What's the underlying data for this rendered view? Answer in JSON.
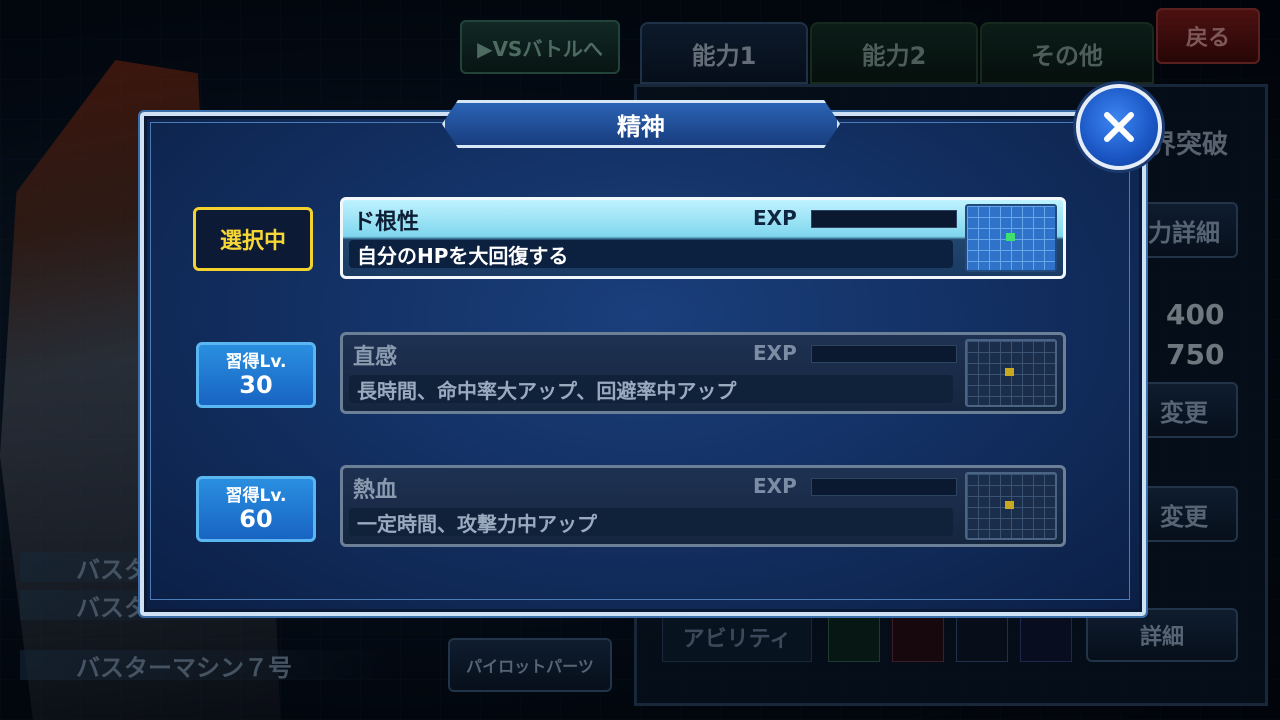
{
  "background": {
    "vs_battle_button": "▶VSバトルへ",
    "back_button": "戻る",
    "tabs": [
      "能力1",
      "能力2",
      "その他"
    ],
    "right_panel": {
      "limit_break": "界突破",
      "ability_detail_button": "力詳細",
      "stat_values": [
        "400",
        "750"
      ],
      "change_buttons": [
        "変更",
        "変更"
      ],
      "ability_label": "アビリティ",
      "detail_button": "詳細"
    },
    "nameplates": [
      "バスタ",
      "バスタ",
      "バスターマシン７号"
    ],
    "pilot_parts_button": "パイロットパーツ"
  },
  "dialog": {
    "title": "精神",
    "colors": {
      "accent": "#1a56c4",
      "selected": "#f6d736",
      "learn": "#2a8fe0"
    },
    "skills": [
      {
        "badge_type": "selected",
        "badge_label": "選択中",
        "name": "ド根性",
        "exp_label": "EXP",
        "exp_progress": 0,
        "description": "自分のHPを大回復する",
        "marker_color": "#40e070"
      },
      {
        "badge_type": "learn",
        "badge_label": "習得Lv.",
        "badge_level": "30",
        "name": "直感",
        "exp_label": "EXP",
        "exp_progress": 0,
        "description": "長時間、命中率大アップ、回避率中アップ",
        "marker_color": "#c8a820"
      },
      {
        "badge_type": "learn",
        "badge_label": "習得Lv.",
        "badge_level": "60",
        "name": "熱血",
        "exp_label": "EXP",
        "exp_progress": 0,
        "description": "一定時間、攻撃力中アップ",
        "marker_color": "#c8a820"
      }
    ]
  }
}
